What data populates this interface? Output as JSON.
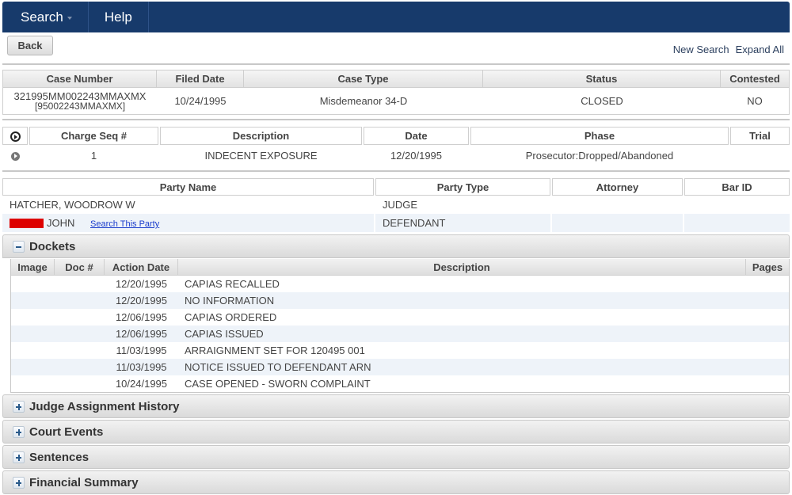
{
  "nav": {
    "search_label": "Search",
    "help_label": "Help"
  },
  "toolbar": {
    "back_label": "Back",
    "new_search_label": "New Search",
    "expand_all_label": "Expand All"
  },
  "case": {
    "headers": [
      "Case Number",
      "Filed Date",
      "Case Type",
      "Status",
      "Contested"
    ],
    "case_number": "321995MM002243MMAXMX",
    "case_number_alt": "[95002243MMAXMX]",
    "filed_date": "10/24/1995",
    "case_type": "Misdemeanor 34-D",
    "status": "CLOSED",
    "contested": "NO"
  },
  "charges": {
    "headers": [
      "Charge Seq #",
      "Description",
      "Date",
      "Phase",
      "Trial"
    ],
    "rows": [
      {
        "seq": "1",
        "description": "INDECENT EXPOSURE",
        "date": "12/20/1995",
        "phase": "Prosecutor:Dropped/Abandoned",
        "trial": ""
      }
    ]
  },
  "parties": {
    "headers": [
      "Party Name",
      "Party Type",
      "Attorney",
      "Bar ID"
    ],
    "rows": [
      {
        "name": "HATCHER, WOODROW W",
        "type": "JUDGE",
        "attorney": "",
        "bar_id": "",
        "redacted": false
      },
      {
        "name": "JOHN",
        "type": "DEFENDANT",
        "attorney": "",
        "bar_id": "",
        "redacted": true,
        "link": "Search This Party"
      }
    ]
  },
  "dockets": {
    "title": "Dockets",
    "headers": [
      "Image",
      "Doc #",
      "Action Date",
      "Description",
      "Pages"
    ],
    "rows": [
      {
        "image": "",
        "doc": "",
        "date": "12/20/1995",
        "description": "CAPIAS RECALLED",
        "pages": ""
      },
      {
        "image": "",
        "doc": "",
        "date": "12/20/1995",
        "description": "NO INFORMATION",
        "pages": ""
      },
      {
        "image": "",
        "doc": "",
        "date": "12/06/1995",
        "description": "CAPIAS ORDERED",
        "pages": ""
      },
      {
        "image": "",
        "doc": "",
        "date": "12/06/1995",
        "description": "CAPIAS ISSUED",
        "pages": ""
      },
      {
        "image": "",
        "doc": "",
        "date": "11/03/1995",
        "description": "ARRAIGNMENT SET FOR 120495 001",
        "pages": ""
      },
      {
        "image": "",
        "doc": "",
        "date": "11/03/1995",
        "description": "NOTICE ISSUED TO DEFENDANT ARN",
        "pages": ""
      },
      {
        "image": "",
        "doc": "",
        "date": "10/24/1995",
        "description": "CASE OPENED - SWORN COMPLAINT",
        "pages": ""
      }
    ]
  },
  "sections": [
    {
      "label": "Judge Assignment History",
      "expanded": false
    },
    {
      "label": "Court Events",
      "expanded": false
    },
    {
      "label": "Sentences",
      "expanded": false
    },
    {
      "label": "Financial Summary",
      "expanded": false
    }
  ],
  "colors": {
    "navbar": "#173a6b",
    "redaction": "#dd0000",
    "link": "#1a3ccc",
    "alt_row": "#eef3f9"
  }
}
